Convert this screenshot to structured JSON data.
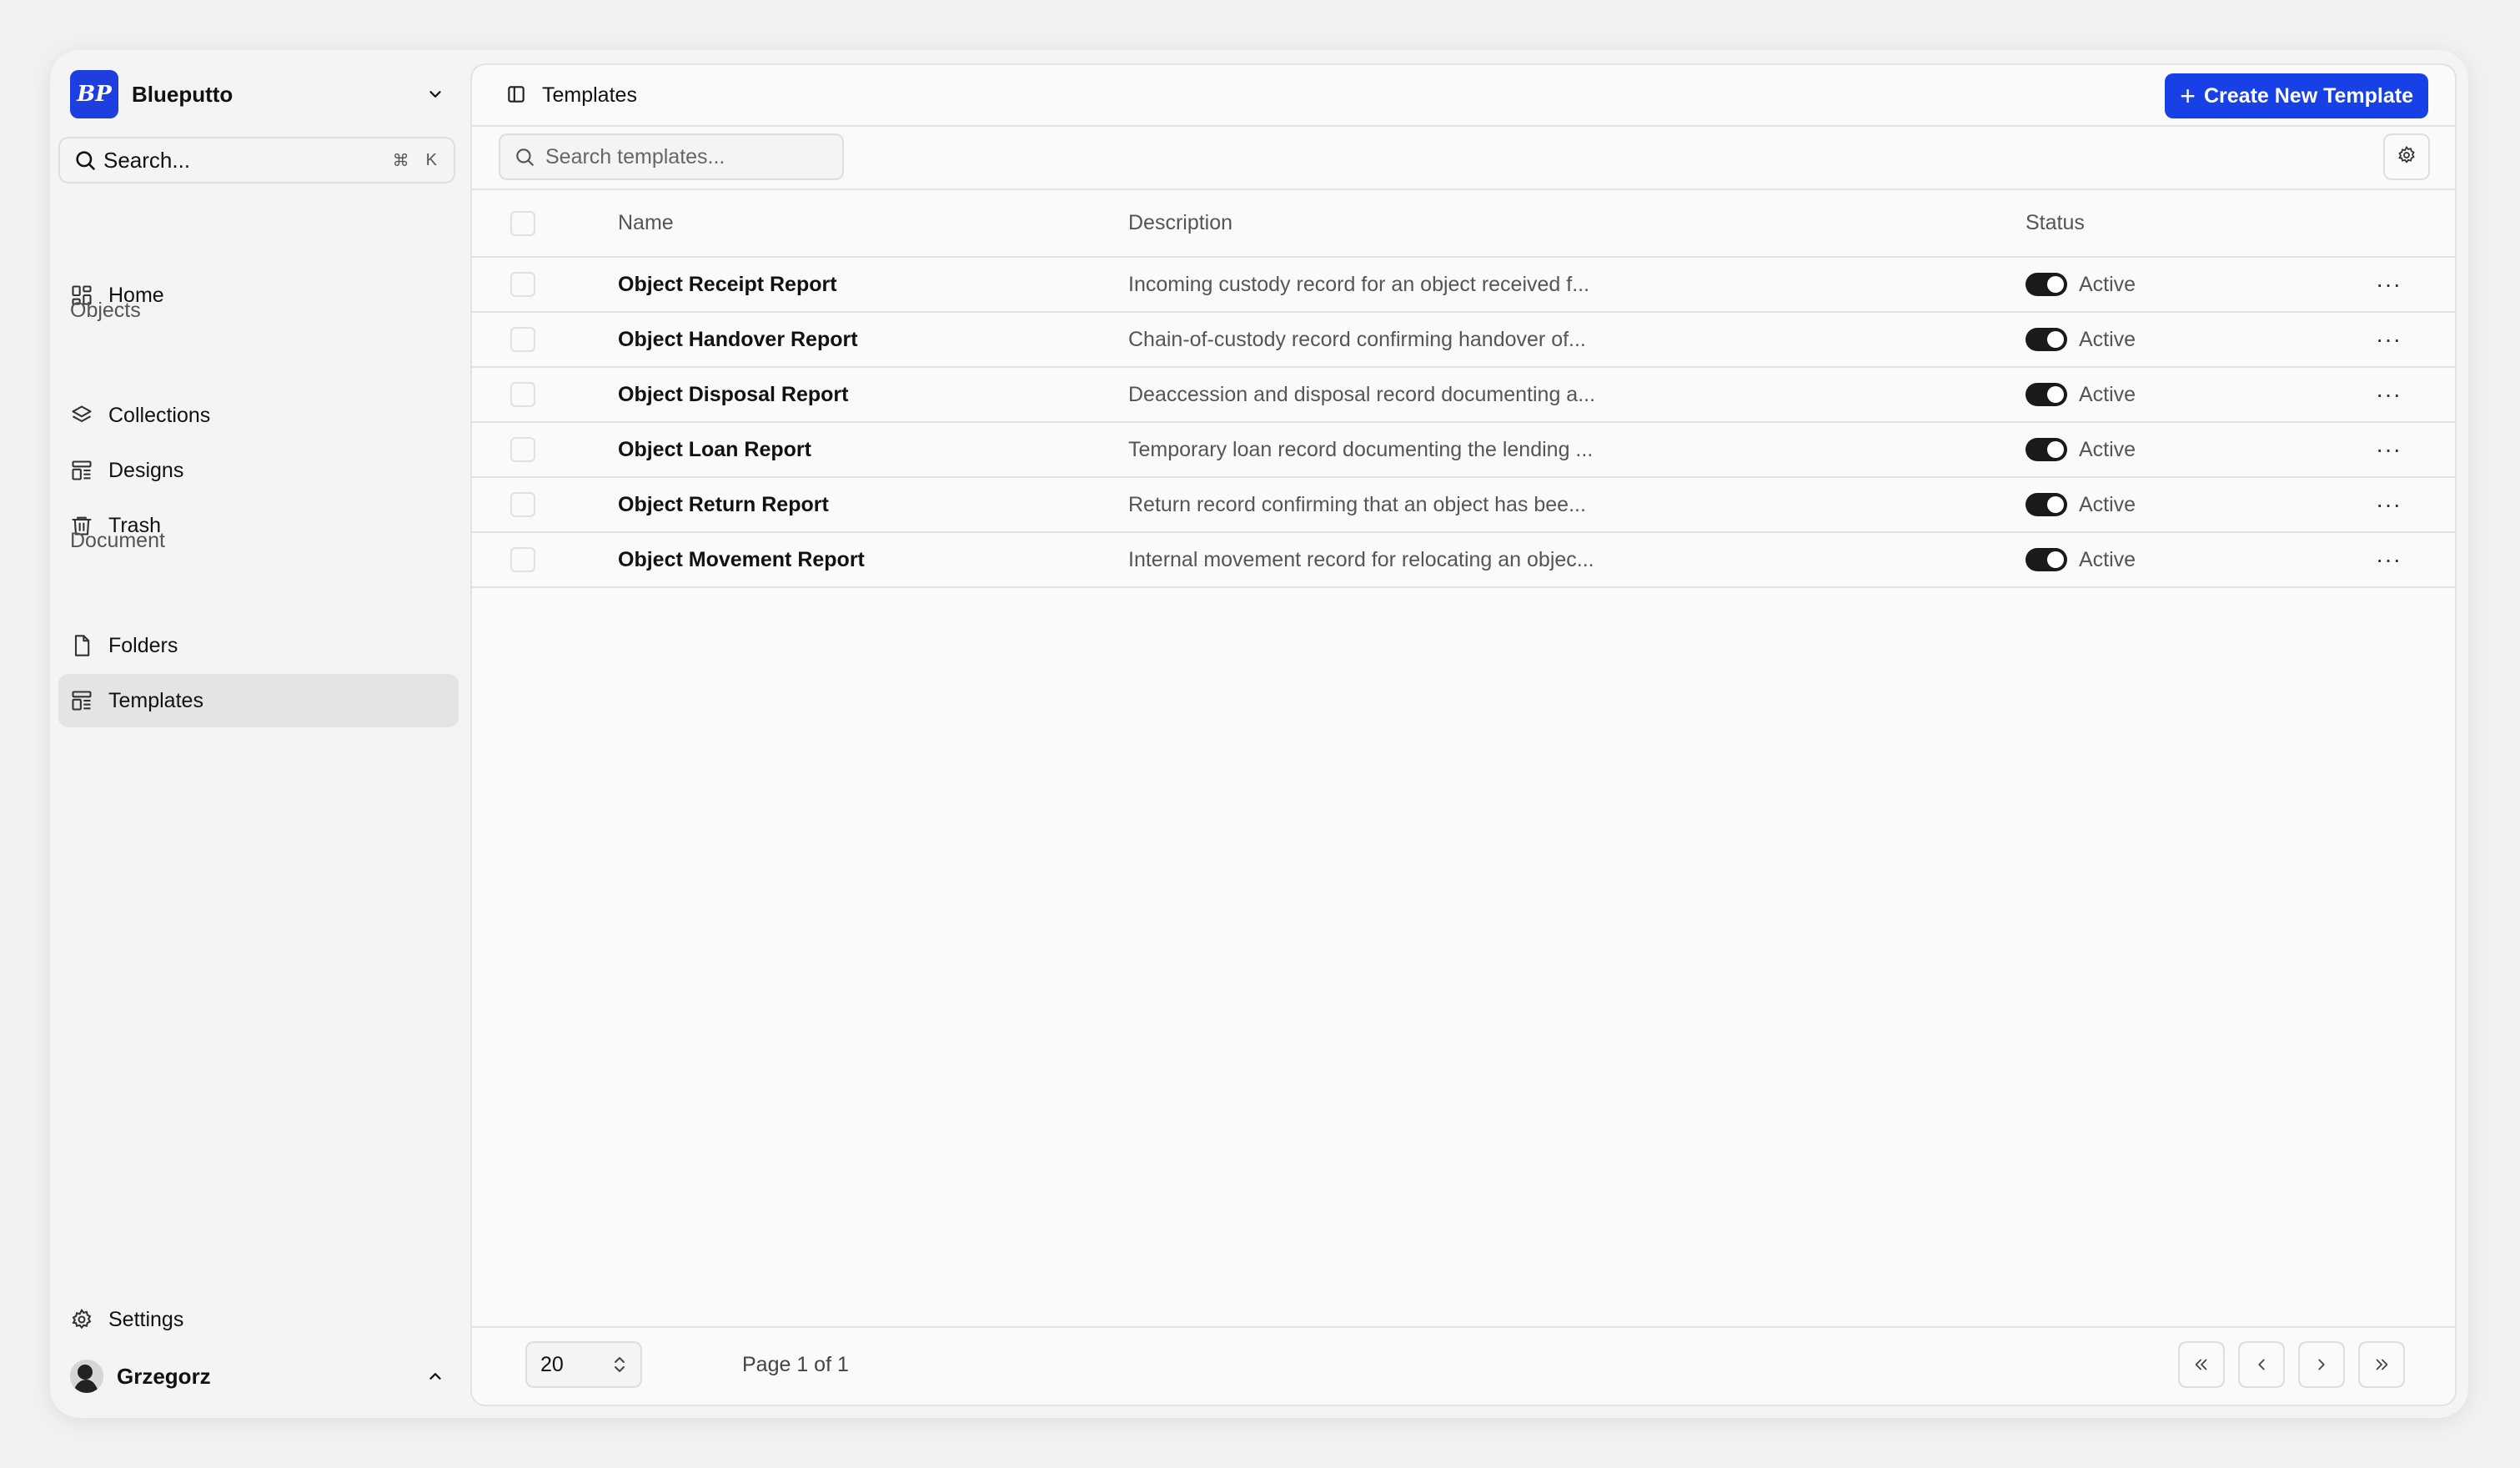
{
  "workspace": {
    "name": "Blueputto",
    "logo_text": "BP"
  },
  "search": {
    "placeholder": "Search...",
    "shortcut_mod": "⌘",
    "shortcut_key": "K"
  },
  "sidebar": {
    "home": "Home",
    "section_objects": "Objects",
    "collections": "Collections",
    "designs": "Designs",
    "trash": "Trash",
    "section_document": "Document",
    "folders": "Folders",
    "templates": "Templates",
    "settings": "Settings",
    "user": "Grzegorz"
  },
  "header": {
    "title": "Templates",
    "create_label": "Create New Template"
  },
  "toolbar": {
    "search_placeholder": "Search templates..."
  },
  "table": {
    "columns": {
      "name": "Name",
      "description": "Description",
      "status": "Status"
    },
    "rows": [
      {
        "name": "Object Receipt Report",
        "description": "Incoming custody record for an object received f...",
        "status": "Active"
      },
      {
        "name": "Object Handover Report",
        "description": "Chain-of-custody record confirming handover of...",
        "status": "Active"
      },
      {
        "name": "Object Disposal Report",
        "description": "Deaccession and disposal record documenting a...",
        "status": "Active"
      },
      {
        "name": "Object Loan Report",
        "description": "Temporary loan record documenting the lending ...",
        "status": "Active"
      },
      {
        "name": "Object Return Report",
        "description": "Return record confirming that an object has bee...",
        "status": "Active"
      },
      {
        "name": "Object Movement Report",
        "description": "Internal movement record for relocating an objec...",
        "status": "Active"
      }
    ],
    "row_menu": "···"
  },
  "footer": {
    "page_size": "20",
    "page_info": "Page 1 of 1"
  },
  "colors": {
    "accent": "#1740e6",
    "toggle_on": "#1a1a1a"
  }
}
